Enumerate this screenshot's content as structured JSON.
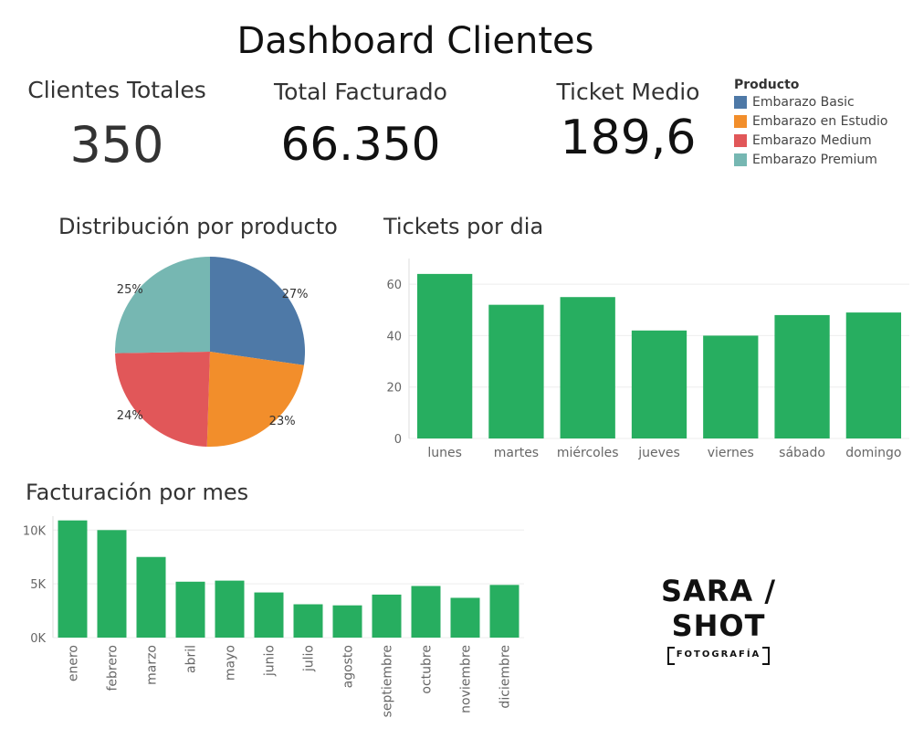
{
  "title": "Dashboard Clientes",
  "kpis": [
    {
      "label": "Clientes Totales",
      "value": "350"
    },
    {
      "label": "Total Facturado",
      "value": "66.350"
    },
    {
      "label": "Ticket Medio",
      "value": "189,6"
    }
  ],
  "legend": {
    "title": "Producto",
    "items": [
      {
        "label": "Embarazo Basic",
        "color": "#4e79a7"
      },
      {
        "label": "Embarazo en Estudio",
        "color": "#f28e2b"
      },
      {
        "label": "Embarazo Medium",
        "color": "#e15759"
      },
      {
        "label": "Embarazo Premium",
        "color": "#76b7b2"
      }
    ]
  },
  "logo": {
    "main": "SARA / SHOT",
    "sub": "FOTOGRAFÍA"
  },
  "chart_data": [
    {
      "type": "pie",
      "title": "Distribución por producto",
      "categories": [
        "Embarazo Basic",
        "Embarazo en Estudio",
        "Embarazo Medium",
        "Embarazo Premium"
      ],
      "values": [
        27,
        23,
        24,
        25
      ],
      "labels": [
        "27%",
        "23%",
        "24%",
        "25%"
      ],
      "colors": [
        "#4e79a7",
        "#f28e2b",
        "#e15759",
        "#76b7b2"
      ]
    },
    {
      "type": "bar",
      "title": "Tickets por dia",
      "categories": [
        "lunes",
        "martes",
        "miércoles",
        "jueves",
        "viernes",
        "sábado",
        "domingo"
      ],
      "values": [
        64,
        52,
        55,
        42,
        40,
        48,
        49
      ],
      "ylim": [
        0,
        70
      ],
      "yticks": [
        0,
        20,
        40,
        60
      ],
      "ytick_labels": [
        "0",
        "20",
        "40",
        "60"
      ],
      "color": "#27ae60",
      "grid": true
    },
    {
      "type": "bar",
      "title": "Facturación por mes",
      "categories": [
        "enero",
        "febrero",
        "marzo",
        "abril",
        "mayo",
        "junio",
        "julio",
        "agosto",
        "septiembre",
        "octubre",
        "noviembre",
        "diciembre"
      ],
      "values": [
        10900,
        10000,
        7500,
        5200,
        5300,
        4200,
        3100,
        3000,
        4000,
        4800,
        3700,
        4900
      ],
      "ylim": [
        0,
        11300
      ],
      "yticks": [
        0,
        5000,
        10000
      ],
      "ytick_labels": [
        "0K",
        "5K",
        "10K"
      ],
      "color": "#27ae60",
      "grid": true
    }
  ]
}
